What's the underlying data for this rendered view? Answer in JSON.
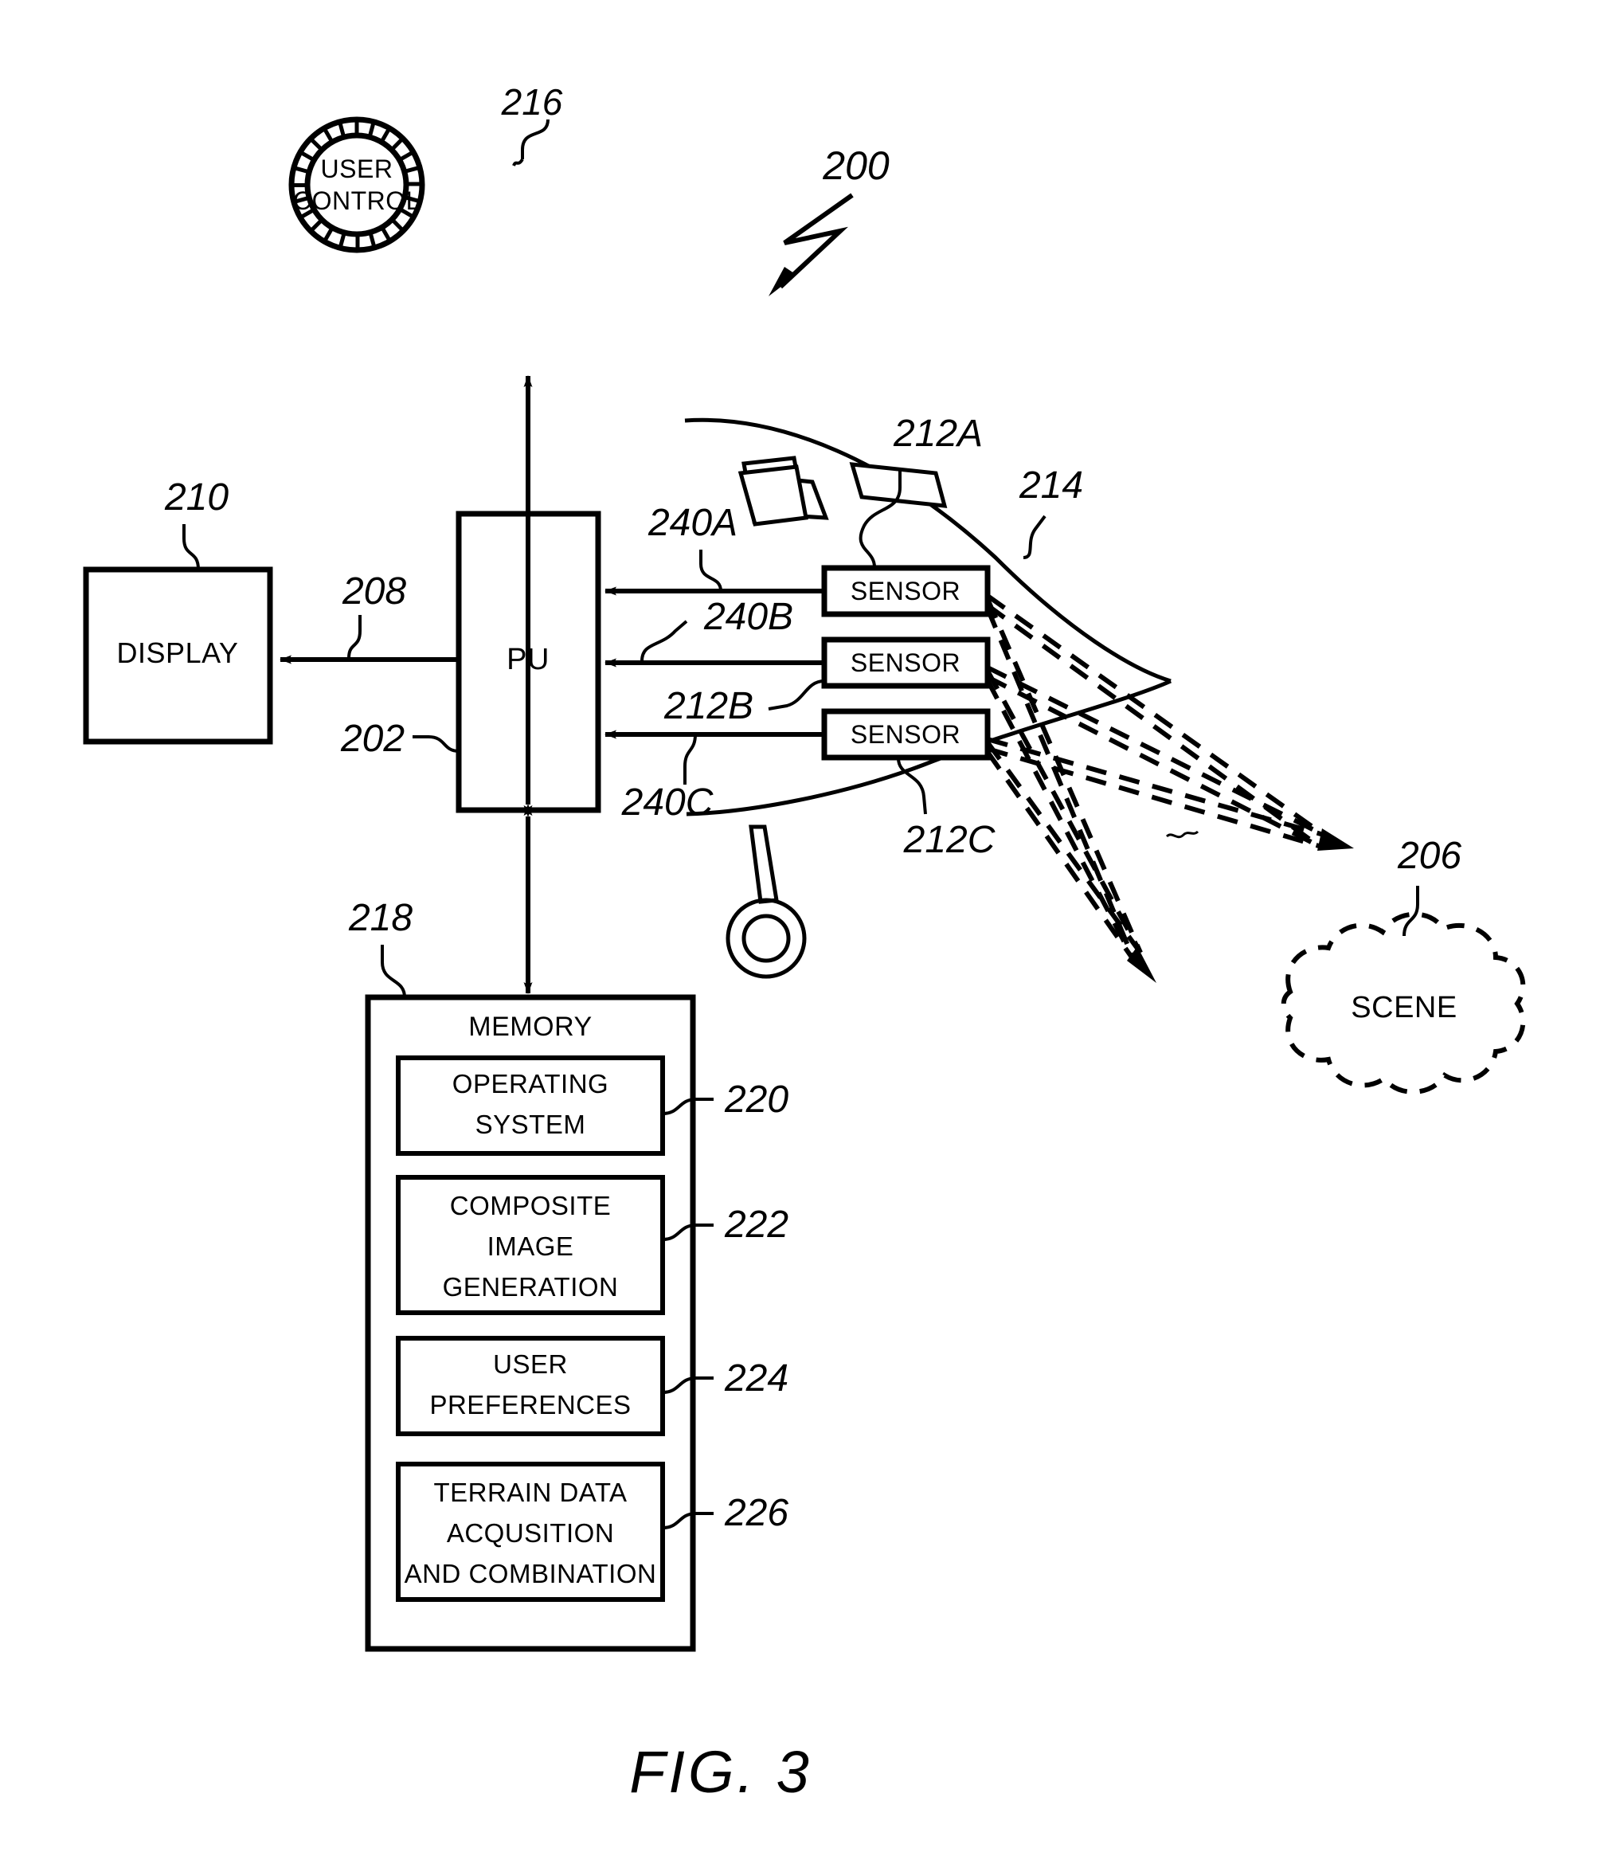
{
  "figure": {
    "caption": "FIG. 3",
    "system_ref": "200"
  },
  "nodes": {
    "user_control": {
      "label_line1": "USER",
      "label_line2": "CONTROL",
      "ref": "216"
    },
    "display": {
      "label": "DISPLAY",
      "ref": "210"
    },
    "pu": {
      "label": "PU",
      "ref": "202"
    },
    "memory": {
      "label": "MEMORY",
      "ref": "218",
      "modules": [
        {
          "lines": [
            "OPERATING",
            "SYSTEM"
          ],
          "ref": "220"
        },
        {
          "lines": [
            "COMPOSITE",
            "IMAGE",
            "GENERATION"
          ],
          "ref": "222"
        },
        {
          "lines": [
            "USER",
            "PREFERENCES"
          ],
          "ref": "224"
        },
        {
          "lines": [
            "TERRAIN DATA",
            "ACQUSITION",
            "AND COMBINATION"
          ],
          "ref": "226"
        }
      ]
    },
    "sensors": [
      {
        "label": "SENSOR",
        "ref": "212A",
        "link_ref": "240A"
      },
      {
        "label": "SENSOR",
        "ref": "212B",
        "link_ref": "240B"
      },
      {
        "label": "SENSOR",
        "ref": "212C",
        "link_ref": "240C"
      }
    ],
    "aircraft": {
      "ref": "214"
    },
    "scene": {
      "label": "SCENE",
      "ref": "206"
    },
    "display_link": {
      "ref": "208"
    }
  },
  "style": {
    "ink": "#000000",
    "paper": "#ffffff"
  }
}
